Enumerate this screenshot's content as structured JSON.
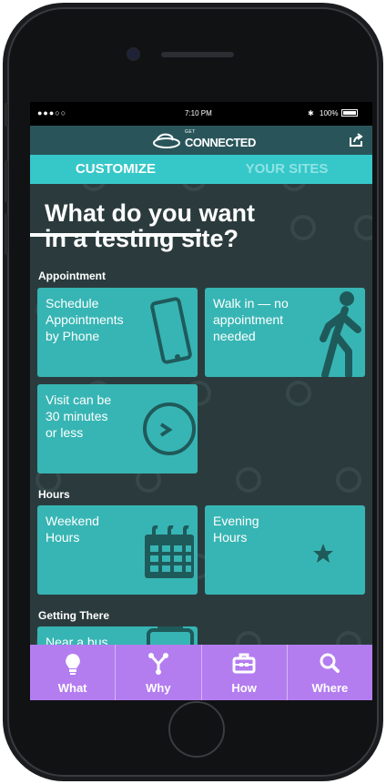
{
  "status_bar": {
    "signal": "●●●○○",
    "time": "7:10 PM",
    "bluetooth": "✱",
    "battery": "100%"
  },
  "header": {
    "logo_small": "GET",
    "logo_word": "CONNECTED"
  },
  "tabs": [
    {
      "label": "CUSTOMIZE",
      "active": true
    },
    {
      "label": "YOUR SITES",
      "active": false
    }
  ],
  "main": {
    "title_line1": "What do you want",
    "title_line2": "in a testing site?",
    "sections": [
      {
        "label": "Appointment",
        "cards": [
          {
            "line1": "Schedule",
            "line2": "Appointments",
            "line3": "by Phone",
            "icon": "phone-icon"
          },
          {
            "line1": "Walk in — no",
            "line2": "appointment",
            "line3": "needed",
            "icon": "walking-person-icon"
          },
          {
            "line1": "Visit can be",
            "line2": "30 minutes",
            "line3": "or less",
            "icon": "clock-icon"
          }
        ]
      },
      {
        "label": "Hours",
        "cards": [
          {
            "line1": "Weekend",
            "line2": "Hours",
            "icon": "calendar-icon"
          },
          {
            "line1": "Evening",
            "line2": "Hours",
            "icon": "moon-star-icon"
          }
        ]
      },
      {
        "label": "Getting There",
        "cards": [
          {
            "line1": "Near a bus",
            "icon": "bus-icon"
          }
        ]
      }
    ]
  },
  "bottom_nav": [
    {
      "label": "What",
      "icon": "lightbulb-icon"
    },
    {
      "label": "Why",
      "icon": "branch-icon"
    },
    {
      "label": "How",
      "icon": "toolbox-icon"
    },
    {
      "label": "Where",
      "icon": "search-icon"
    }
  ],
  "colors": {
    "header": "#29555a",
    "tabs": "#36c7c9",
    "card": "#37b5b4",
    "background": "#2b3b3d",
    "nav": "#b37df0"
  }
}
